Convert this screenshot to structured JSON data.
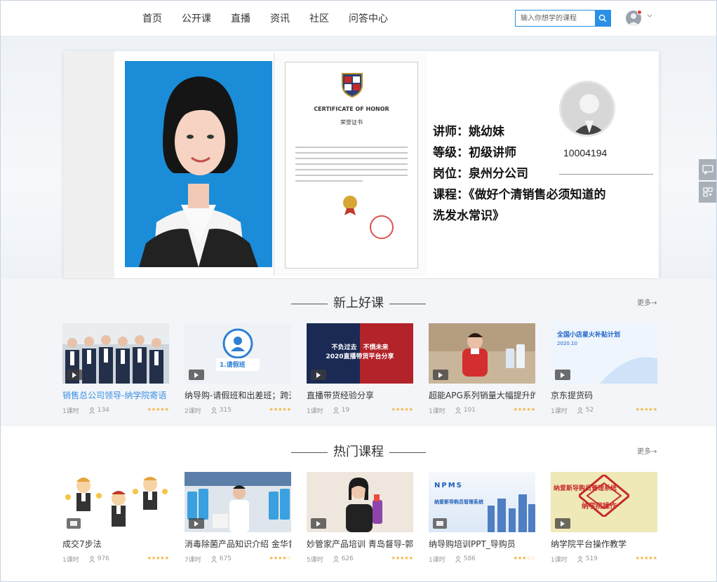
{
  "nav": {
    "items": [
      "首页",
      "公开课",
      "直播",
      "资讯",
      "社区",
      "问答中心"
    ]
  },
  "search": {
    "placeholder": "输入你想学的课程"
  },
  "banner": {
    "cert_title": "CERTIFICATE OF HONOR",
    "cert_subtitle": "荣誉证书",
    "info_lines": [
      "讲师：姚幼妹",
      "等级：初级讲师",
      "岗位：泉州分公司",
      "课程：《做好个清销售必须知道的",
      "洗发水常识》"
    ],
    "instructor_id": "10004194"
  },
  "sections": [
    {
      "title": "新上好课",
      "more": "更多→",
      "courses": [
        {
          "title": "销售总公司领导-纳学院寄语",
          "lessons": "1课时",
          "views": "134",
          "highlight": true,
          "thumb": "team",
          "media": "video"
        },
        {
          "title": "纳导购-请假班和出差班；跨天",
          "lessons": "2课时",
          "views": "315",
          "highlight": false,
          "thumb": "leave",
          "media": "video"
        },
        {
          "title": "直播带货经验分享",
          "lessons": "1课时",
          "views": "19",
          "highlight": false,
          "thumb": "live",
          "media": "video"
        },
        {
          "title": "超能APG系列销量大幅提升的",
          "lessons": "1课时",
          "views": "101",
          "highlight": false,
          "thumb": "apg",
          "media": "video"
        },
        {
          "title": "京东提货码",
          "lessons": "1课时",
          "views": "52",
          "highlight": false,
          "thumb": "jd",
          "media": "video"
        }
      ]
    },
    {
      "title": "热门课程",
      "more": "更多→",
      "courses": [
        {
          "title": "成交7步法",
          "lessons": "1课时",
          "views": "976",
          "highlight": false,
          "thumb": "cartoon",
          "media": "image"
        },
        {
          "title": "消毒除菌产品知识介绍 金华督",
          "lessons": "7课时",
          "views": "675",
          "highlight": false,
          "thumb": "disinfect",
          "media": "video"
        },
        {
          "title": "妙管家产品培训 青岛督导-郭",
          "lessons": "5课时",
          "views": "626",
          "highlight": false,
          "thumb": "miao",
          "media": "video"
        },
        {
          "title": "纳导购培训PPT_导购员",
          "lessons": "1课时",
          "views": "586",
          "highlight": false,
          "thumb": "npms",
          "media": "image"
        },
        {
          "title": "纳学院平台操作教学",
          "lessons": "1课时",
          "views": "519",
          "highlight": false,
          "thumb": "platform",
          "media": "video"
        }
      ]
    }
  ],
  "thumb_text": {
    "leave": "1.请假班",
    "live_line1": "不负过去　不惧未来",
    "live_line2": "2020直播带货平台分享",
    "jd_line1": "全国小店星火补贴计划",
    "jd_line2": "2020.10",
    "npms_brand": "NPMS",
    "npms_line": "纳爱斯导购员管理系统",
    "platform_line1": "纳爱斯导购员管理系统",
    "platform_line2": "纳学院操作"
  }
}
